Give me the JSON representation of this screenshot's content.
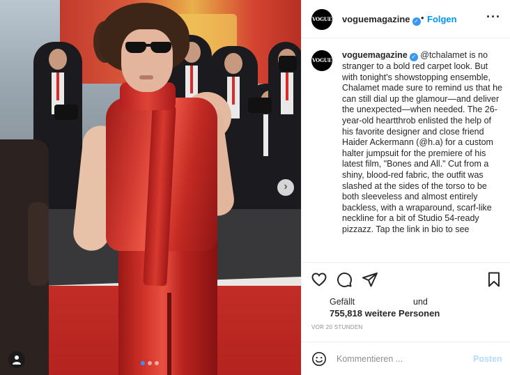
{
  "post": {
    "username": "voguemagazine",
    "avatar_text": "VOGUE",
    "separator": "•",
    "follow_label": "Folgen",
    "more_label": "···",
    "caption_username": "voguemagazine",
    "caption_text": "@tchalamet is no stranger to a bold red carpet look. But with tonight's showstopping ensemble, Chalamet made sure to remind us that he can still dial up the glamour—and deliver the unexpected—when needed. The 26-year-old heartthrob enlisted the help of his favorite designer and close friend Haider Ackermann (@h.a) for a custom halter jumpsuit for the premiere of his latest film, \"Bones and All.\" Cut from a shiny, blood-red fabric, the outfit was slashed at the sides of the torso to be both sleeveless and almost entirely backless, with a wraparound, scarf-like neckline for a bit of Studio 54-ready pizzazz. Tap the link in bio to see"
  },
  "media": {
    "next_label": "›",
    "carousel_count": 3,
    "carousel_active": 1
  },
  "actions": {
    "likes_prefix": "Gefällt",
    "likes_conj": "und",
    "likes_count_text": "755,818 weitere Personen",
    "timestamp": "VOR 20 STUNDEN"
  },
  "comment": {
    "placeholder": "Kommentieren ...",
    "post_label": "Posten"
  },
  "colors": {
    "accent": "#0095f6",
    "verified": "#3897f0",
    "post_disabled": "#b3dbff",
    "muted": "#8e8e8e"
  },
  "icons": [
    "heart-icon",
    "comment-icon",
    "share-icon",
    "bookmark-icon",
    "emoji-icon",
    "user-tag-icon",
    "chevron-right-icon",
    "verified-icon",
    "more-icon"
  ]
}
